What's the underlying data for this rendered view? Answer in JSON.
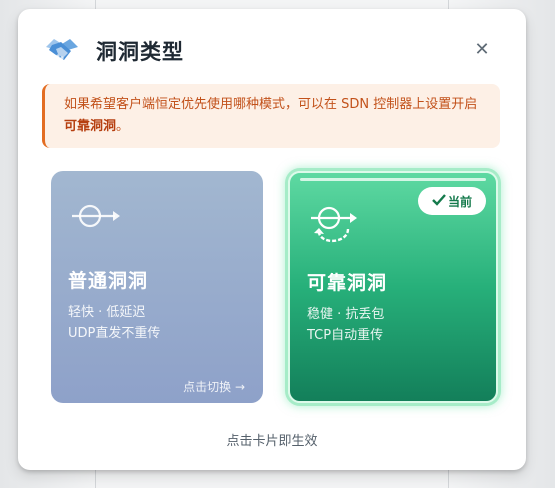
{
  "dialog": {
    "title": "洞洞类型",
    "close_icon": "close-icon"
  },
  "notice": {
    "text_before": "如果希望客户端恒定优先使用哪种模式，可以在 SDN 控制器上设置开启",
    "highlight": "可靠洞洞",
    "text_after": "。"
  },
  "cards": {
    "normal": {
      "title": "普通洞洞",
      "desc1": "轻快 · 低延迟",
      "desc2": "UDP直发不重传",
      "action": "点击切换 →",
      "icon": "passthrough-icon"
    },
    "reliable": {
      "title": "可靠洞洞",
      "desc1": "稳健 · 抗丢包",
      "desc2": "TCP自动重传",
      "badge": "当前",
      "icon": "retransmit-icon"
    }
  },
  "footer": {
    "hint": "点击卡片即生效"
  },
  "colors": {
    "accent_orange": "#e36d22",
    "reliable_green": "#27b07a",
    "normal_blue": "#8ea1c9"
  }
}
